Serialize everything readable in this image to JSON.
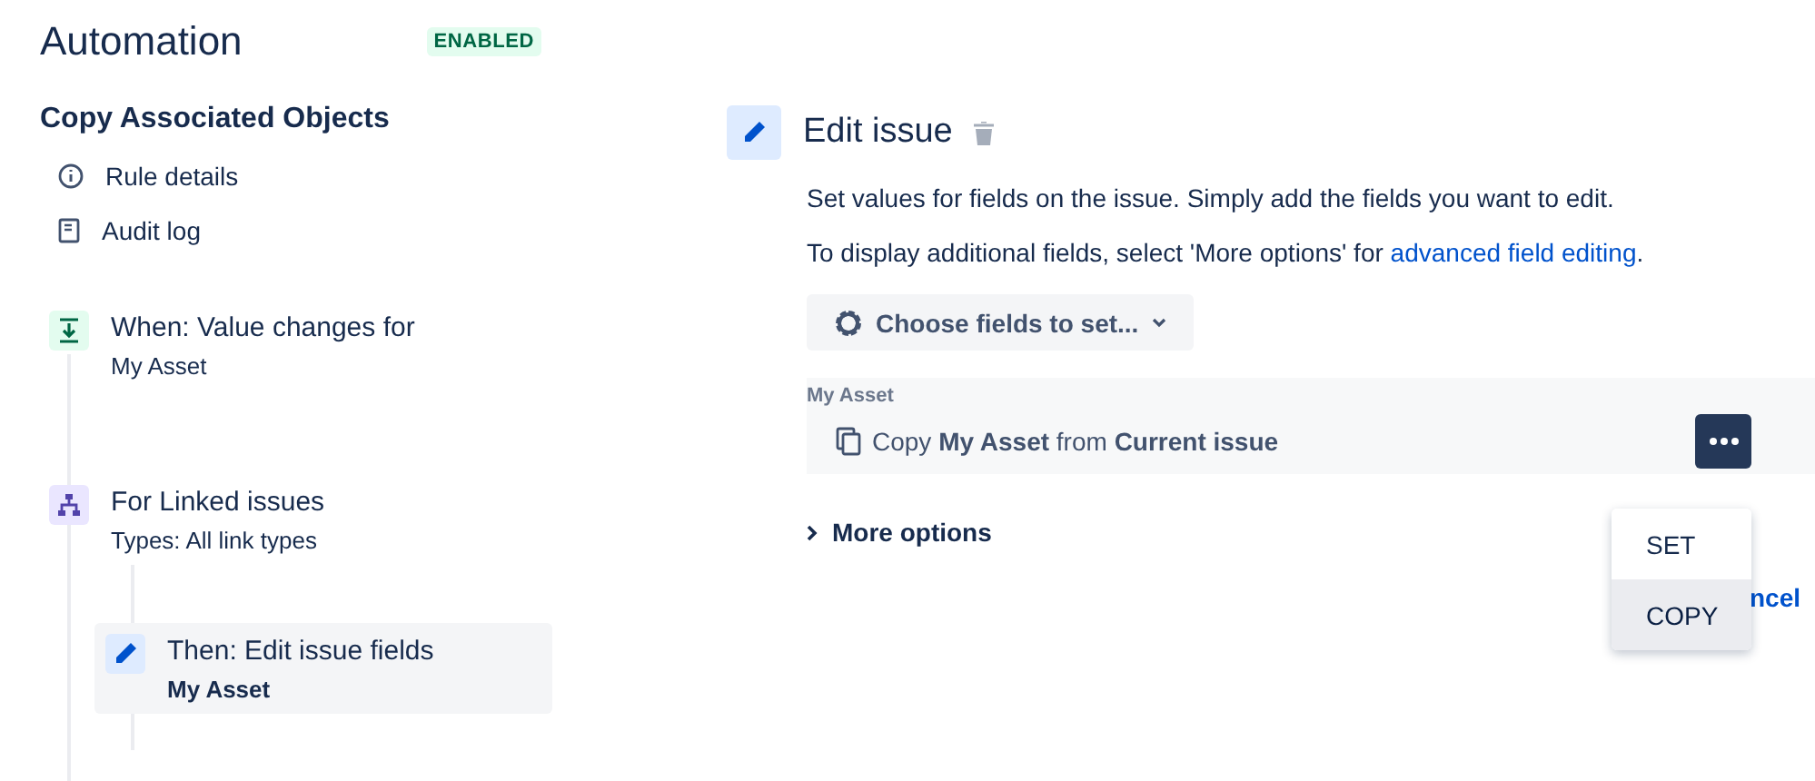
{
  "header": {
    "title": "Automation",
    "status": "ENABLED"
  },
  "rule": {
    "name": "Copy Associated Objects",
    "links": [
      {
        "kind": "info",
        "label": "Rule details"
      },
      {
        "kind": "log",
        "label": "Audit log"
      }
    ]
  },
  "steps": [
    {
      "kind": "trigger",
      "title": "When: Value changes for",
      "detail": "My Asset",
      "selected": false
    },
    {
      "kind": "branch",
      "title": "For Linked issues",
      "detail": "Types: All link types",
      "selected": false,
      "children": [
        {
          "kind": "action",
          "title": "Then: Edit issue fields",
          "detail": "My Asset",
          "selected": true
        }
      ]
    }
  ],
  "editor": {
    "title": "Edit issue",
    "description": "Set values for fields on the issue. Simply add the fields you want to edit.",
    "hint": "To display additional fields, select 'More options' for",
    "hint_link": "advanced field editing",
    "hint_end": ".",
    "choose_button": "Choose fields to set...",
    "field": {
      "label": "My Asset",
      "value": "Copy **My Asset** from **Current issue**"
    },
    "more_options": "More options",
    "cancel": "ncel"
  },
  "menu": [
    {
      "label": "SET",
      "selected": false
    },
    {
      "label": "COPY",
      "selected": true
    }
  ]
}
